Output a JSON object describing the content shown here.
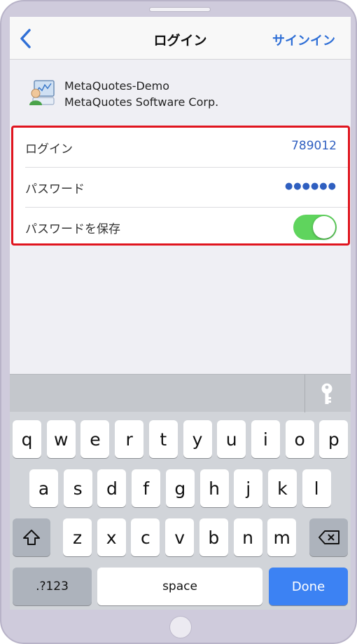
{
  "nav": {
    "title": "ログイン",
    "action": "サインイン"
  },
  "server": {
    "name": "MetaQuotes-Demo",
    "company": "MetaQuotes Software Corp."
  },
  "form": {
    "login_label": "ログイン",
    "login_value": "789012",
    "password_label": "パスワード",
    "password_value": "●●●●●●",
    "save_label": "パスワードを保存",
    "save_enabled": true
  },
  "keyboard": {
    "row1": [
      "q",
      "w",
      "e",
      "r",
      "t",
      "y",
      "u",
      "i",
      "o",
      "p"
    ],
    "row2": [
      "a",
      "s",
      "d",
      "f",
      "g",
      "h",
      "j",
      "k",
      "l"
    ],
    "row3": [
      "z",
      "x",
      "c",
      "v",
      "b",
      "n",
      "m"
    ],
    "numbers_label": ".?123",
    "space_label": "space",
    "done_label": "Done"
  },
  "colors": {
    "accent": "#2f6fd6",
    "toggle_on": "#5fd45d",
    "highlight": "#e0141e",
    "done": "#3c82f3"
  }
}
